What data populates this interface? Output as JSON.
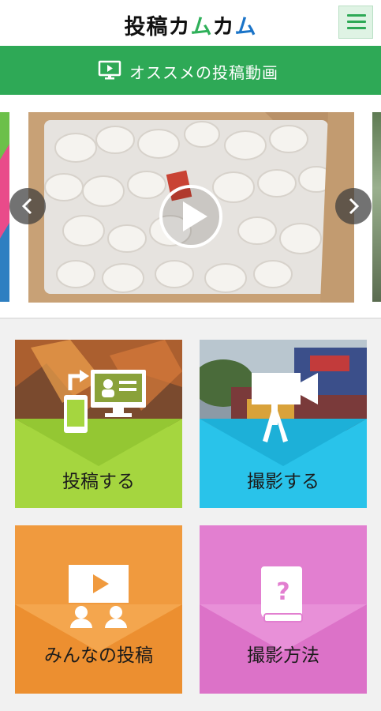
{
  "header": {
    "logo": {
      "part1": "投稿",
      "part2": "カムカム"
    },
    "menu_icon": "hamburger-menu-icon"
  },
  "section": {
    "title": "オススメの投稿動画",
    "icon": "monitor-play-icon"
  },
  "carousel": {
    "prev_icon": "chevron-left-icon",
    "next_icon": "chevron-right-icon",
    "play_icon": "play-icon"
  },
  "tiles": [
    {
      "label": "投稿する",
      "icon": "upload-devices-icon",
      "color": "#a5d63f"
    },
    {
      "label": "撮影する",
      "icon": "video-camera-icon",
      "color": "#29c3ea"
    },
    {
      "label": "みんなの投稿",
      "icon": "audience-screen-icon",
      "color": "#f09a3e"
    },
    {
      "label": "撮影方法",
      "icon": "help-book-icon",
      "color": "#e27fd0"
    }
  ],
  "colors": {
    "brand_green": "#2ea956",
    "page_bg": "#f1f1f1"
  }
}
